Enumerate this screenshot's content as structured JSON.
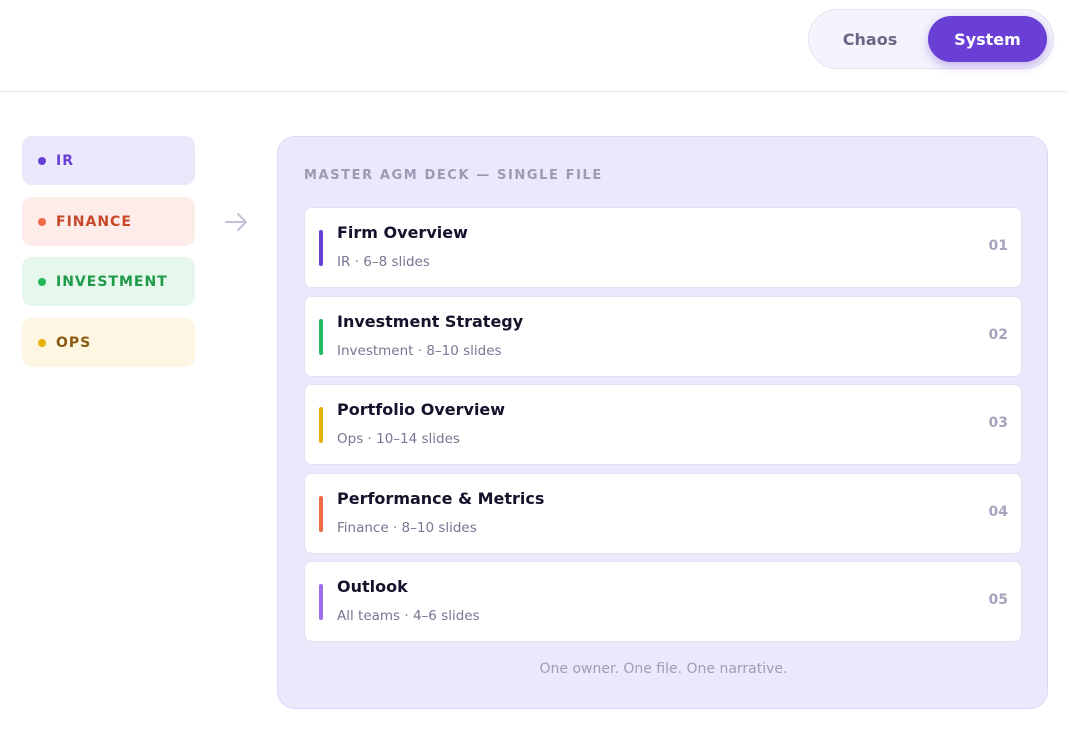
{
  "header": {
    "toggle": {
      "options": [
        "Chaos",
        "System"
      ],
      "selected": "System"
    }
  },
  "teams": [
    {
      "label": "IR",
      "dot_color": "#6a3fd6",
      "text_color": "#6a3fd6",
      "bg": "#ece8fb"
    },
    {
      "label": "FINANCE",
      "dot_color": "#f06a45",
      "text_color": "#c8482a",
      "bg": "#fdecea"
    },
    {
      "label": "INVESTMENT",
      "dot_color": "#22b85b",
      "text_color": "#1e9a4a",
      "bg": "#e6f7ec"
    },
    {
      "label": "OPS",
      "dot_color": "#e6b10a",
      "text_color": "#8a5a12",
      "bg": "#fdf6e3"
    }
  ],
  "arrow_icon": "arrow-right-icon",
  "deck": {
    "title": "MASTER AGM DECK — SINGLE FILE",
    "slides": [
      {
        "name": "Firm Overview",
        "meta": "IR · 6–8 slides",
        "number": "01",
        "color": "#6a3fd6"
      },
      {
        "name": "Investment Strategy",
        "meta": "Investment · 8–10 slides",
        "number": "02",
        "color": "#22b85b"
      },
      {
        "name": "Portfolio Overview",
        "meta": "Ops · 10–14 slides",
        "number": "03",
        "color": "#e6b10a"
      },
      {
        "name": "Performance & Metrics",
        "meta": "Finance · 8–10 slides",
        "number": "04",
        "color": "#f06a45"
      },
      {
        "name": "Outlook",
        "meta": "All teams · 4–6 slides",
        "number": "05",
        "color": "#9b6ff0"
      }
    ],
    "footer": "One owner. One file. One narrative."
  }
}
